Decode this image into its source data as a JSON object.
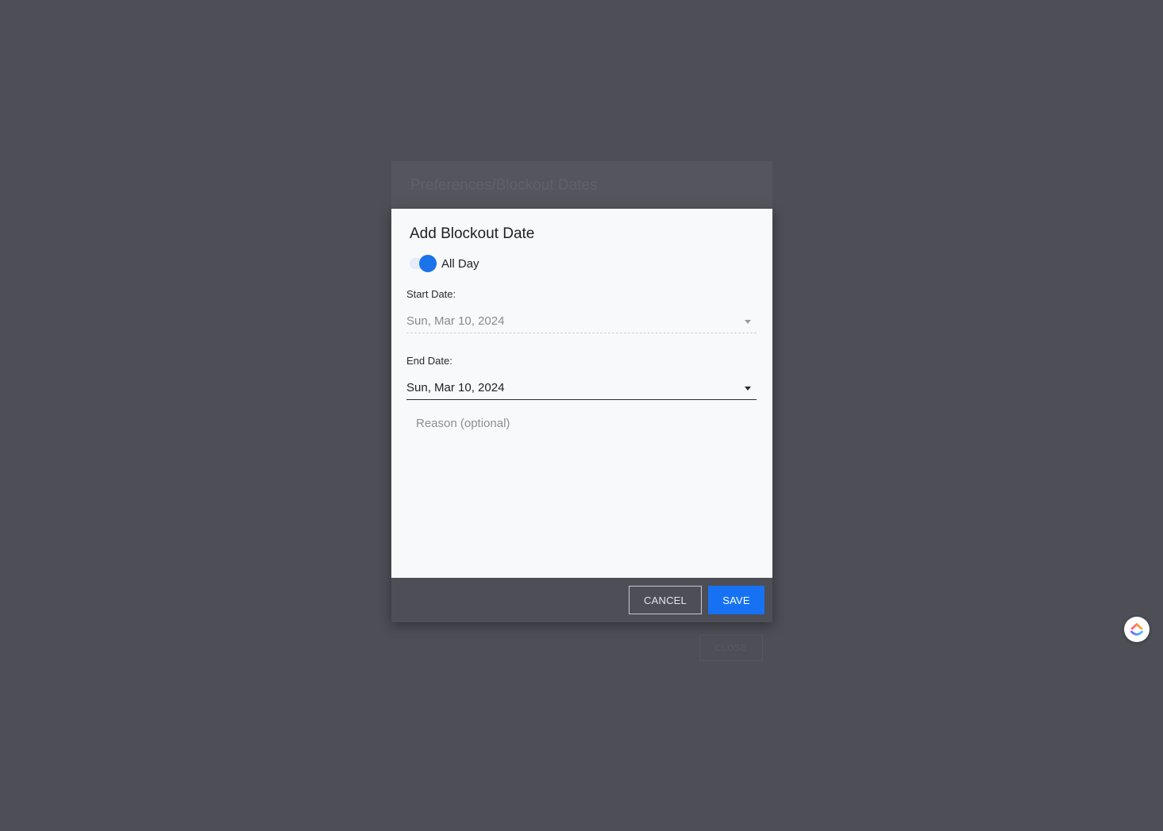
{
  "background_dialog": {
    "title": "Preferences/Blockout Dates",
    "close_label": "CLOSE"
  },
  "modal": {
    "title": "Add Blockout Date",
    "all_day": {
      "label": "All Day",
      "checked": true
    },
    "start_date": {
      "label": "Start Date:",
      "value": "Sun, Mar 10, 2024",
      "disabled": true
    },
    "end_date": {
      "label": "End Date:",
      "value": "Sun, Mar 10, 2024"
    },
    "reason": {
      "placeholder": "Reason (optional)",
      "value": ""
    },
    "buttons": {
      "cancel": "CANCEL",
      "save": "SAVE"
    }
  },
  "colors": {
    "accent": "#1672f3",
    "overlay": "#4d4e56",
    "modal_bg": "#f8f9fb"
  },
  "icons": {
    "help_widget": "clickup-logo-icon",
    "dropdown": "caret-down-icon"
  }
}
